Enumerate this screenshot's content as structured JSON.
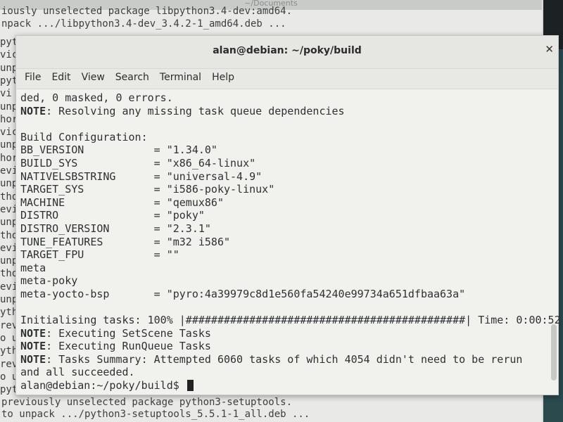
{
  "background_terminal": {
    "title": "~/Documents",
    "top_lines": [
      "iously unselected package libpython3.4-dev:amd64.",
      "npack .../libpython3.4-dev_3.4.2-1_amd64.deb ..."
    ],
    "bottom_lines": [
      "previously unselected package python3-setuptools.",
      "to unpack .../python3-setuptools_5.5.1-1_all.deb ..."
    ],
    "left_fragments": [
      "pyt",
      "vic",
      "unp",
      "pyt",
      "vi",
      "unp",
      "hor",
      "vic",
      "unp",
      "hor",
      "evic",
      "unp",
      "thor",
      "evic",
      "unp",
      "thor",
      "evic",
      "unp",
      "thor",
      "evic",
      "unp",
      "ythor",
      "revic",
      "o unp",
      "ythor",
      "revic",
      "o unp",
      "python"
    ]
  },
  "window": {
    "title": "alan@debian: ~/poky/build",
    "close_icon": "close-icon",
    "menu": [
      "File",
      "Edit",
      "View",
      "Search",
      "Terminal",
      "Help"
    ]
  },
  "terminal": {
    "lines": [
      {
        "bold": "",
        "text": "ded, 0 masked, 0 errors."
      },
      {
        "bold": "NOTE",
        "text": ": Resolving any missing task queue dependencies"
      },
      {
        "bold": "",
        "text": ""
      },
      {
        "bold": "",
        "text": "Build Configuration:"
      },
      {
        "bold": "",
        "text": "BB_VERSION           = \"1.34.0\""
      },
      {
        "bold": "",
        "text": "BUILD_SYS            = \"x86_64-linux\""
      },
      {
        "bold": "",
        "text": "NATIVELSBSTRING      = \"universal-4.9\""
      },
      {
        "bold": "",
        "text": "TARGET_SYS           = \"i586-poky-linux\""
      },
      {
        "bold": "",
        "text": "MACHINE              = \"qemux86\""
      },
      {
        "bold": "",
        "text": "DISTRO               = \"poky\""
      },
      {
        "bold": "",
        "text": "DISTRO_VERSION       = \"2.3.1\""
      },
      {
        "bold": "",
        "text": "TUNE_FEATURES        = \"m32 i586\""
      },
      {
        "bold": "",
        "text": "TARGET_FPU           = \"\""
      },
      {
        "bold": "",
        "text": "meta"
      },
      {
        "bold": "",
        "text": "meta-poky"
      },
      {
        "bold": "",
        "text": "meta-yocto-bsp       = \"pyro:4a39979c8d1e560fa54240e99734a651dfbaa63a\""
      },
      {
        "bold": "",
        "text": ""
      },
      {
        "bold": "",
        "text": "Initialising tasks: 100% |############################################| Time: 0:00:52"
      },
      {
        "bold": "NOTE",
        "text": ": Executing SetScene Tasks"
      },
      {
        "bold": "NOTE",
        "text": ": Executing RunQueue Tasks"
      },
      {
        "bold": "NOTE",
        "text": ": Tasks Summary: Attempted 6060 tasks of which 4054 didn't need to be rerun"
      },
      {
        "bold": "",
        "text": "and all succeeded."
      }
    ],
    "prompt": "alan@debian:~/poky/build$ "
  }
}
